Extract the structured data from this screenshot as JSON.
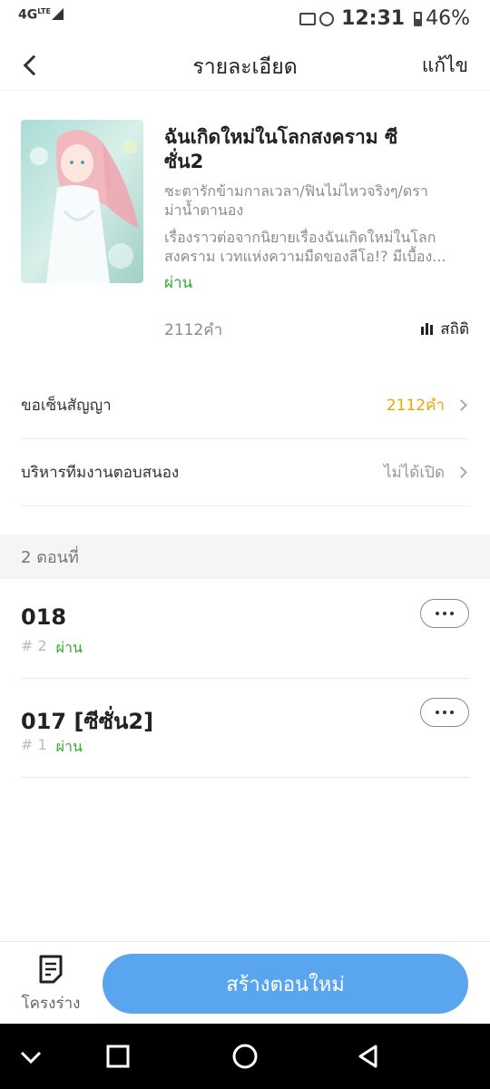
{
  "status_bar": {
    "network": "4G",
    "network_sub": "LTE",
    "time": "12:31",
    "battery": "46%"
  },
  "header": {
    "title": "รายละเอียด",
    "edit_label": "แก้ไข"
  },
  "book": {
    "title": "ฉันเกิดใหม่ในโลกสงคราม ซีซั่น2",
    "tags": "ชะตารักข้ามกาลเวลา/ฟินไม่ไหวจริงๆ/ดราม่าน้ำตานอง",
    "description": "เรื่องราวต่อจากนิยายเรื่องฉันเกิดใหม่ในโลกสงคราม เวทแห่งความมืดของลีโอ!? มีเบื้อง...",
    "status": "ผ่าน",
    "word_count": "2112คำ",
    "stats_label": "สถิติ"
  },
  "settings": [
    {
      "label": "ขอเซ็นสัญญา",
      "value": "2112คำ",
      "value_color": "#f0a30a"
    },
    {
      "label": "บริหารทีมงานตอบสนอง",
      "value": "ไม่ได้เปิด",
      "value_color": "#999999"
    }
  ],
  "chapters_header": "2 ตอนที่",
  "chapters": [
    {
      "title": "018",
      "number": "# 2",
      "status": "ผ่าน"
    },
    {
      "title": "017 [ซีซั่น2]",
      "number": "# 1",
      "status": "ผ่าน"
    }
  ],
  "bottom": {
    "draft_label": "โครงร่าง",
    "create_label": "สร้างตอนใหม่"
  },
  "colors": {
    "accent": "#5aa6ee",
    "pass_green": "#2eaa2e",
    "contract_orange": "#f0a30a"
  }
}
